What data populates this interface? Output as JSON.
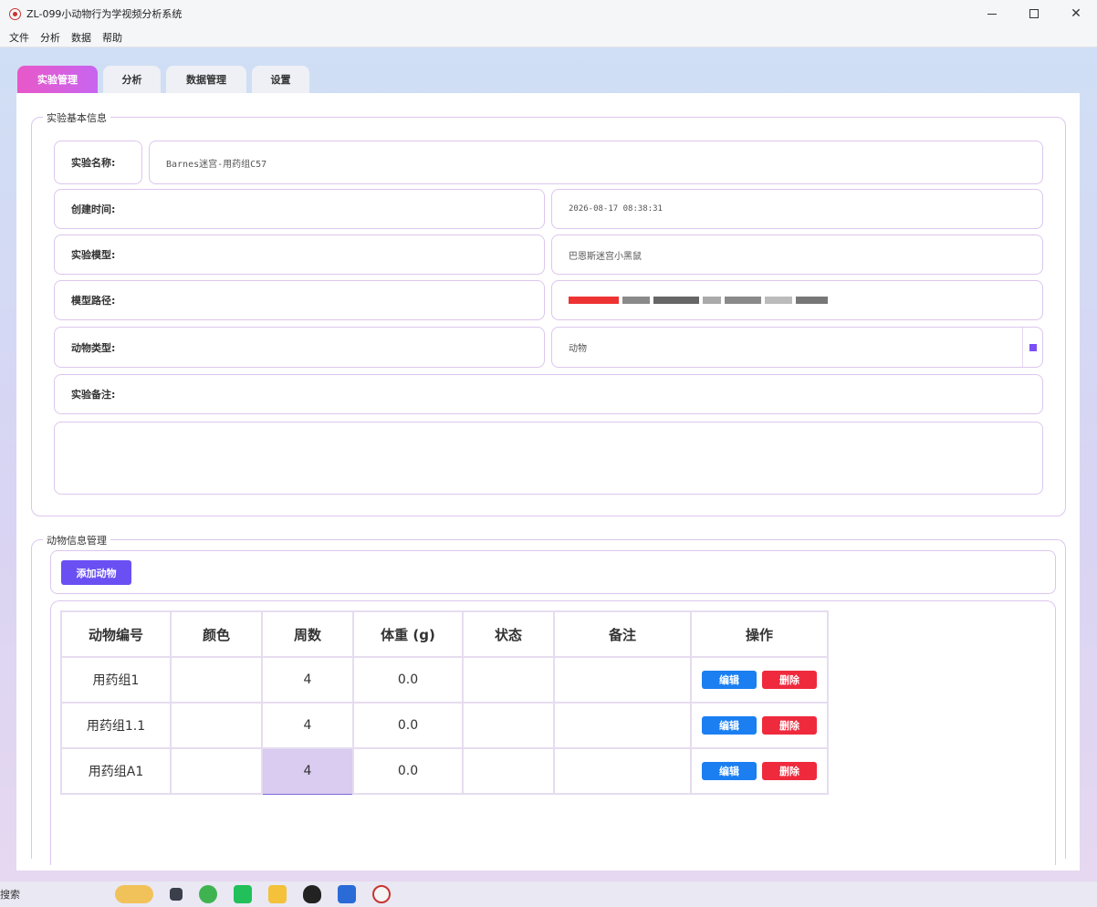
{
  "window": {
    "title": "ZL-099小动物行为学视频分析系统",
    "controls": [
      "—",
      "☐",
      "✕"
    ]
  },
  "menu": [
    "文件",
    "分析",
    "数据",
    "帮助"
  ],
  "tabs": [
    {
      "label": "实验管理",
      "active": true
    },
    {
      "label": "分析",
      "active": false
    },
    {
      "label": "数据管理",
      "active": false
    },
    {
      "label": "设置",
      "active": false
    }
  ],
  "experiment": {
    "group_title": "实验基本信息",
    "name_label": "实验名称:",
    "name_value": "Barnes迷宫-用药组C57",
    "created_label": "创建时间:",
    "created_value": "2026-08-17 08:38:31",
    "model_label": "实验模型:",
    "model_value": "巴恩斯迷宫小黑鼠",
    "path_label": "模型路径:",
    "animal_type_label": "动物类型:",
    "animal_type_value": "动物",
    "notes_label": "实验备注:",
    "notes_value": ""
  },
  "animals": {
    "group_title": "动物信息管理",
    "add_button": "添加动物",
    "columns": [
      "动物编号",
      "颜色",
      "周数",
      "体重 (g)",
      "状态",
      "备注",
      "操作"
    ],
    "rows": [
      {
        "id": "用药组1",
        "color": "",
        "weeks": "4",
        "weight": "0.0",
        "status": "",
        "note": ""
      },
      {
        "id": "用药组1.1",
        "color": "",
        "weeks": "4",
        "weight": "0.0",
        "status": "",
        "note": ""
      },
      {
        "id": "用药组A1",
        "color": "",
        "weeks": "4",
        "weight": "0.0",
        "status": "",
        "note": ""
      }
    ],
    "edit_label": "编辑",
    "delete_label": "删除"
  },
  "taskbar": {
    "search_label": "搜索",
    "icons": [
      "app-icon",
      "file-icon",
      "browser-icon",
      "wechat-icon",
      "folder-icon",
      "qq-icon",
      "word-icon",
      "zl-app-icon"
    ]
  },
  "colors": {
    "accent": "#6a4ff3",
    "tab_active_from": "#e858c8",
    "tab_active_to": "#c865f0",
    "border": "#dcc6ee",
    "edit": "#1b7ff2",
    "delete": "#ef2a3d"
  }
}
